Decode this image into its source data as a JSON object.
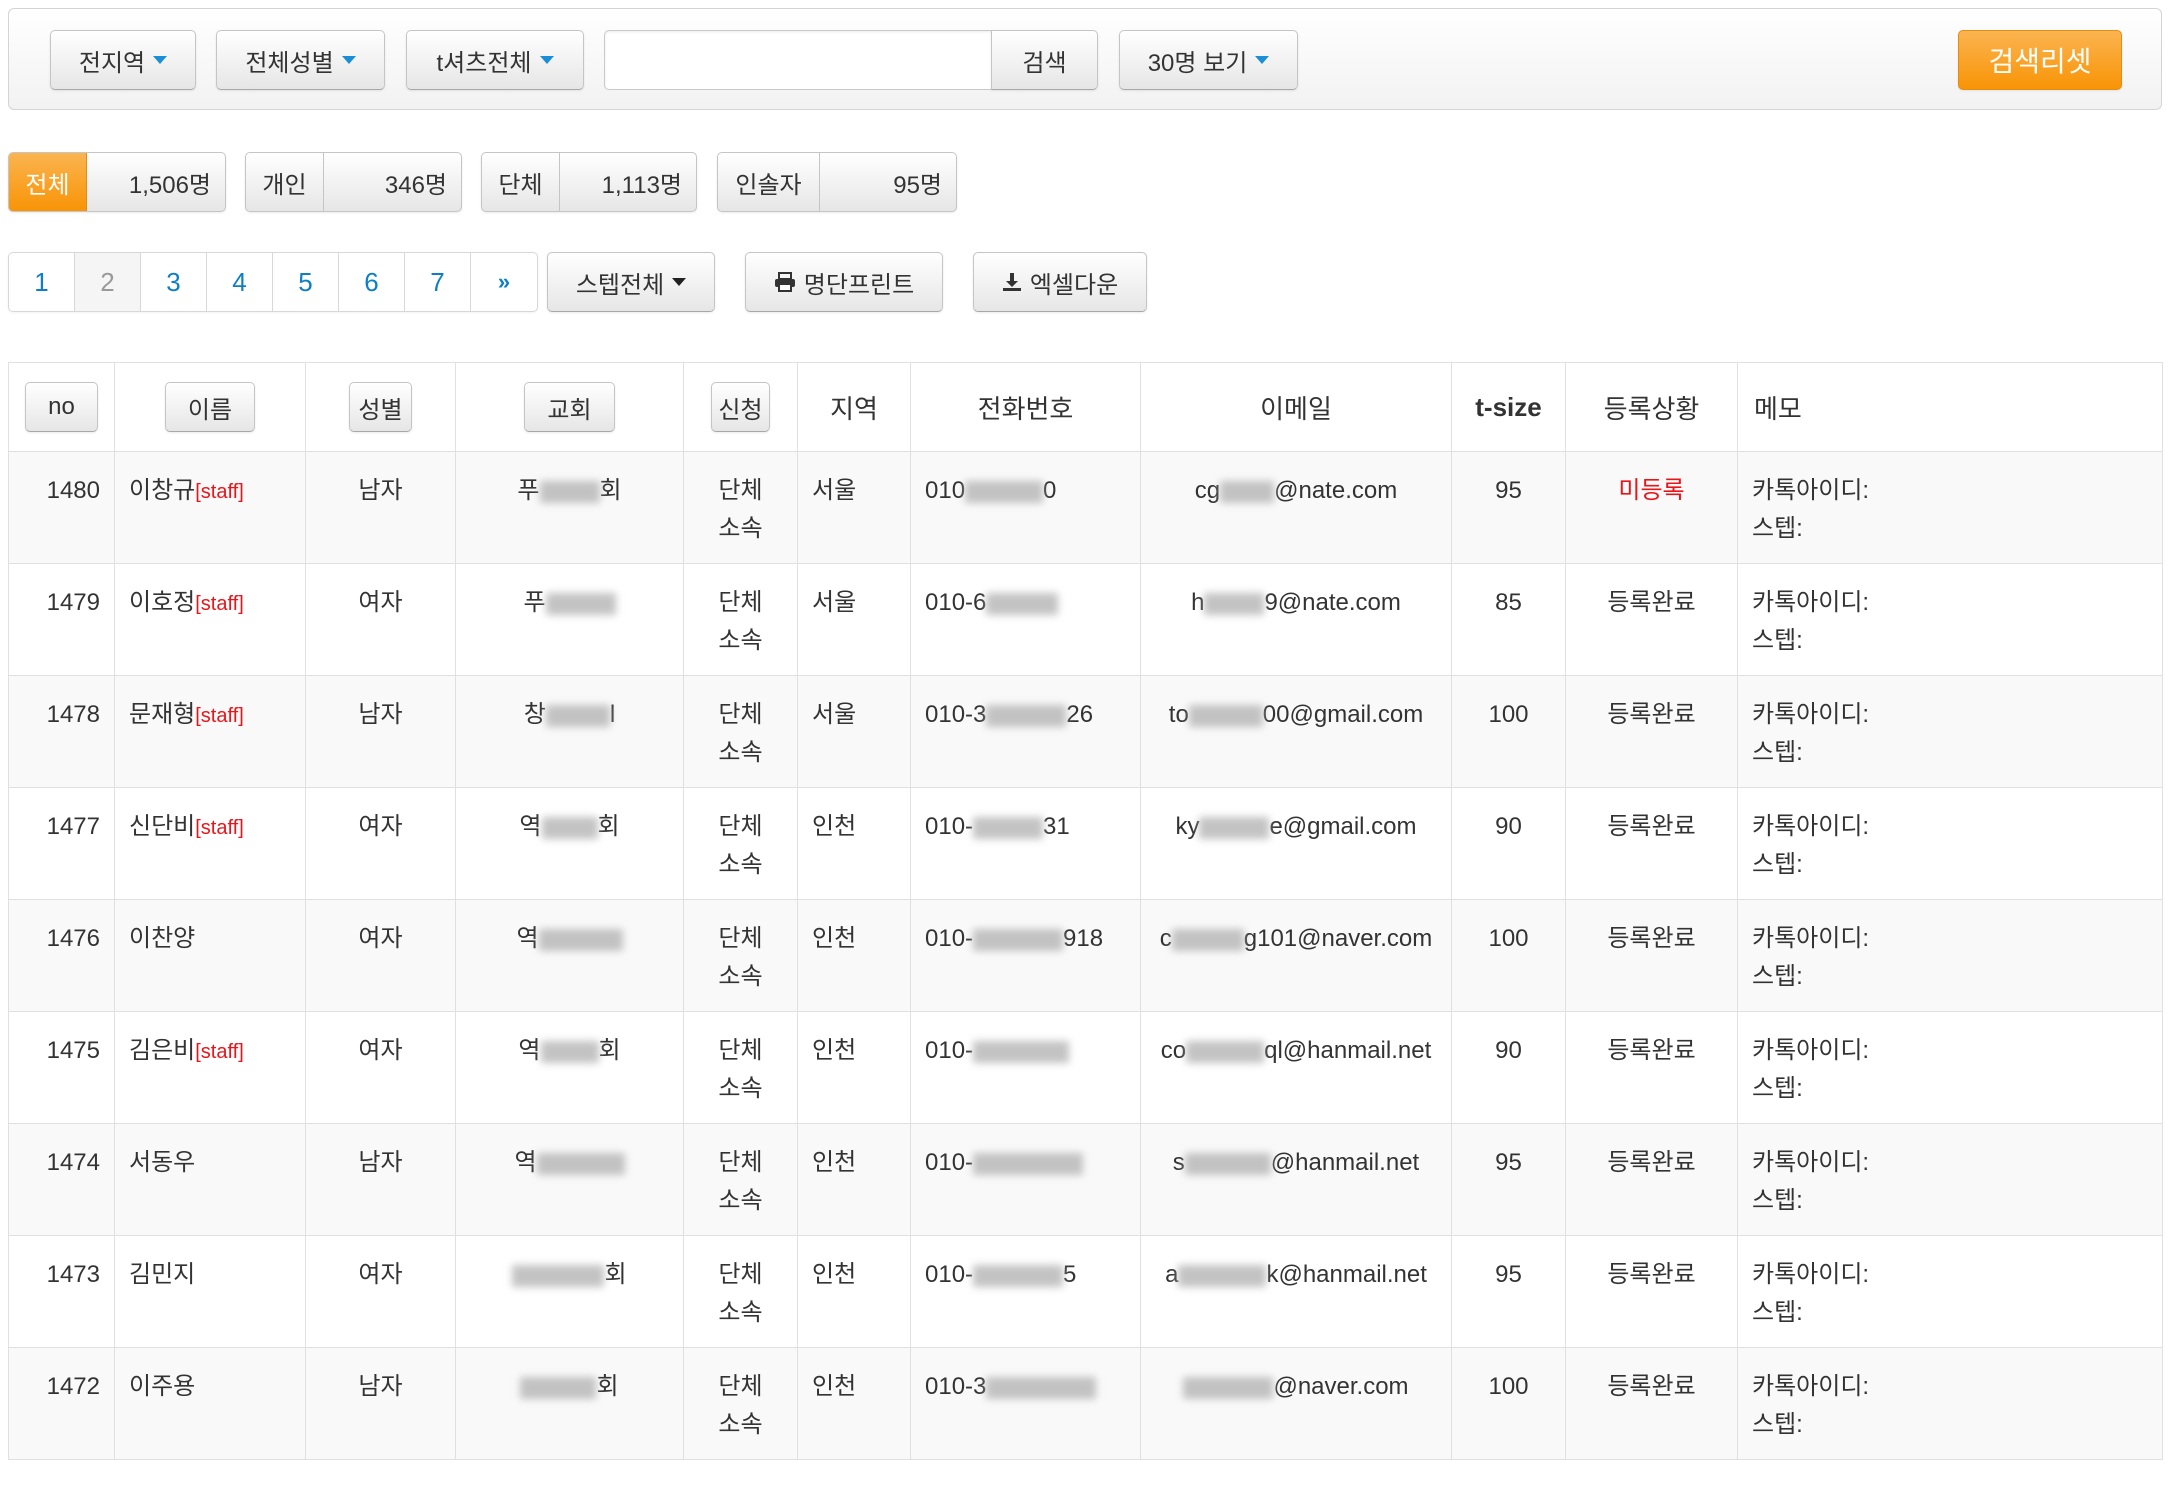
{
  "filters": {
    "region": "전지역",
    "gender": "전체성별",
    "tshirt": "t셔츠전체",
    "search_placeholder": "",
    "search_button": "검색",
    "per_page": "30명 보기",
    "reset_button": "검색리셋"
  },
  "stats": [
    {
      "label": "전체",
      "count": "1,506명"
    },
    {
      "label": "개인",
      "count": "346명"
    },
    {
      "label": "단체",
      "count": "1,113명"
    },
    {
      "label": "인솔자",
      "count": "95명"
    }
  ],
  "pagination": {
    "pages": [
      "1",
      "2",
      "3",
      "4",
      "5",
      "6",
      "7"
    ],
    "current": "2",
    "next": "»"
  },
  "actions": {
    "step_filter": "스텝전체",
    "print_label": "명단프린트",
    "excel_label": "엑셀다운"
  },
  "table": {
    "headers": {
      "no": "no",
      "name": "이름",
      "gender": "성별",
      "church": "교회",
      "apply": "신청",
      "region": "지역",
      "phone": "전화번호",
      "email": "이메일",
      "tsize": "t-size",
      "status": "등록상황",
      "memo": "메모"
    },
    "rows": [
      {
        "no": "1480",
        "name": "이창규",
        "tag": "[staff]",
        "gender": "남자",
        "church_a": "푸",
        "church_b": "회",
        "apply1": "단체",
        "apply2": "소속",
        "region": "서울",
        "phone_a": "010",
        "phone_b": "0",
        "email_a": "cg",
        "email_b": "@nate.com",
        "tsize": "95",
        "status": "미등록",
        "memo1": "카톡아이디:",
        "memo2": "스텝:"
      },
      {
        "no": "1479",
        "name": "이호정",
        "tag": "[staff]",
        "gender": "여자",
        "church_a": "푸",
        "church_b": "",
        "apply1": "단체",
        "apply2": "소속",
        "region": "서울",
        "phone_a": "010-6",
        "phone_b": "",
        "email_a": "h",
        "email_b": "9@nate.com",
        "tsize": "85",
        "status": "등록완료",
        "memo1": "카톡아이디:",
        "memo2": "스텝:"
      },
      {
        "no": "1478",
        "name": "문재형",
        "tag": "[staff]",
        "gender": "남자",
        "church_a": "창",
        "church_b": "l",
        "apply1": "단체",
        "apply2": "소속",
        "region": "서울",
        "phone_a": "010-3",
        "phone_b": "26",
        "email_a": "to",
        "email_b": "00@gmail.com",
        "tsize": "100",
        "status": "등록완료",
        "memo1": "카톡아이디:",
        "memo2": "스텝:"
      },
      {
        "no": "1477",
        "name": "신단비",
        "tag": "[staff]",
        "gender": "여자",
        "church_a": "역",
        "church_b": "회",
        "apply1": "단체",
        "apply2": "소속",
        "region": "인천",
        "phone_a": "010-",
        "phone_b": "31",
        "email_a": "ky",
        "email_b": "e@gmail.com",
        "tsize": "90",
        "status": "등록완료",
        "memo1": "카톡아이디:",
        "memo2": "스텝:"
      },
      {
        "no": "1476",
        "name": "이찬양",
        "tag": "",
        "gender": "여자",
        "church_a": "역",
        "church_b": "",
        "apply1": "단체",
        "apply2": "소속",
        "region": "인천",
        "phone_a": "010-",
        "phone_b": "918",
        "email_a": "c",
        "email_b": "g101@naver.com",
        "tsize": "100",
        "status": "등록완료",
        "memo1": "카톡아이디:",
        "memo2": "스텝:"
      },
      {
        "no": "1475",
        "name": "김은비",
        "tag": "[staff]",
        "gender": "여자",
        "church_a": "역",
        "church_b": "회",
        "apply1": "단체",
        "apply2": "소속",
        "region": "인천",
        "phone_a": "010-",
        "phone_b": "",
        "email_a": "co",
        "email_b": "ql@hanmail.net",
        "tsize": "90",
        "status": "등록완료",
        "memo1": "카톡아이디:",
        "memo2": "스텝:"
      },
      {
        "no": "1474",
        "name": "서동우",
        "tag": "",
        "gender": "남자",
        "church_a": "역",
        "church_b": "",
        "apply1": "단체",
        "apply2": "소속",
        "region": "인천",
        "phone_a": "010-",
        "phone_b": "",
        "email_a": "s",
        "email_b": "@hanmail.net",
        "tsize": "95",
        "status": "등록완료",
        "memo1": "카톡아이디:",
        "memo2": "스텝:"
      },
      {
        "no": "1473",
        "name": "김민지",
        "tag": "",
        "gender": "여자",
        "church_a": "",
        "church_b": "회",
        "apply1": "단체",
        "apply2": "소속",
        "region": "인천",
        "phone_a": "010-",
        "phone_b": "5",
        "email_a": "a",
        "email_b": "k@hanmail.net",
        "tsize": "95",
        "status": "등록완료",
        "memo1": "카톡아이디:",
        "memo2": "스텝:"
      },
      {
        "no": "1472",
        "name": "이주용",
        "tag": "",
        "gender": "남자",
        "church_a": "",
        "church_b": "회",
        "apply1": "단체",
        "apply2": "소속",
        "region": "인천",
        "phone_a": "010-3",
        "phone_b": "",
        "email_a": "",
        "email_b": "@naver.com",
        "tsize": "100",
        "status": "등록완료",
        "memo1": "카톡아이디:",
        "memo2": "스텝:"
      }
    ]
  },
  "colors": {
    "accent_orange": "#f89406",
    "link_blue": "#0e7fc5",
    "staff_red": "#e8161a"
  }
}
